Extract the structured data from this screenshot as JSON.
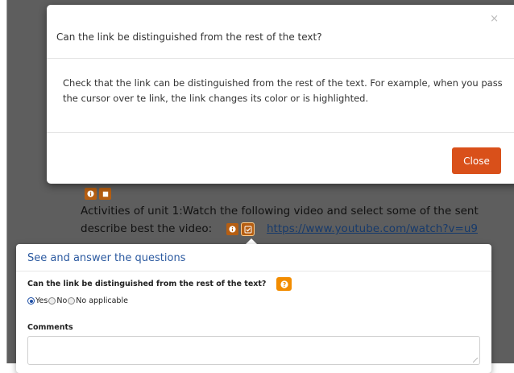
{
  "modal": {
    "close_x": "×",
    "title": "Can the link be distinguished from the rest of the text?",
    "body": "Check that the link can be distinguished from the rest of the text. For example, when you pass the cursor over te link, the link changes its color or is highlighted.",
    "close_button": "Close"
  },
  "content": {
    "activity_line1": "Activities of unit 1:Watch the following video and select some of the sent",
    "activity_line2": "describe best the video:",
    "link": "https://www.youtube.com/watch?v=u9"
  },
  "popover": {
    "title": "See and answer the questions",
    "question": "Can the link be distinguished from the rest of the text?",
    "options": [
      "Yes",
      "No",
      "No applicable"
    ],
    "selected": "Yes",
    "comments_label": "Comments",
    "comments_value": ""
  },
  "icons": {
    "info": "info-icon",
    "stop": "stop-icon",
    "check": "check-icon",
    "help": "question-icon"
  },
  "colors": {
    "overlay": "#5e5e5e",
    "icon_bg": "#b55e12",
    "close_button": "#d9501a",
    "help_button": "#f28c00",
    "popover_title": "#2c5aa0"
  }
}
